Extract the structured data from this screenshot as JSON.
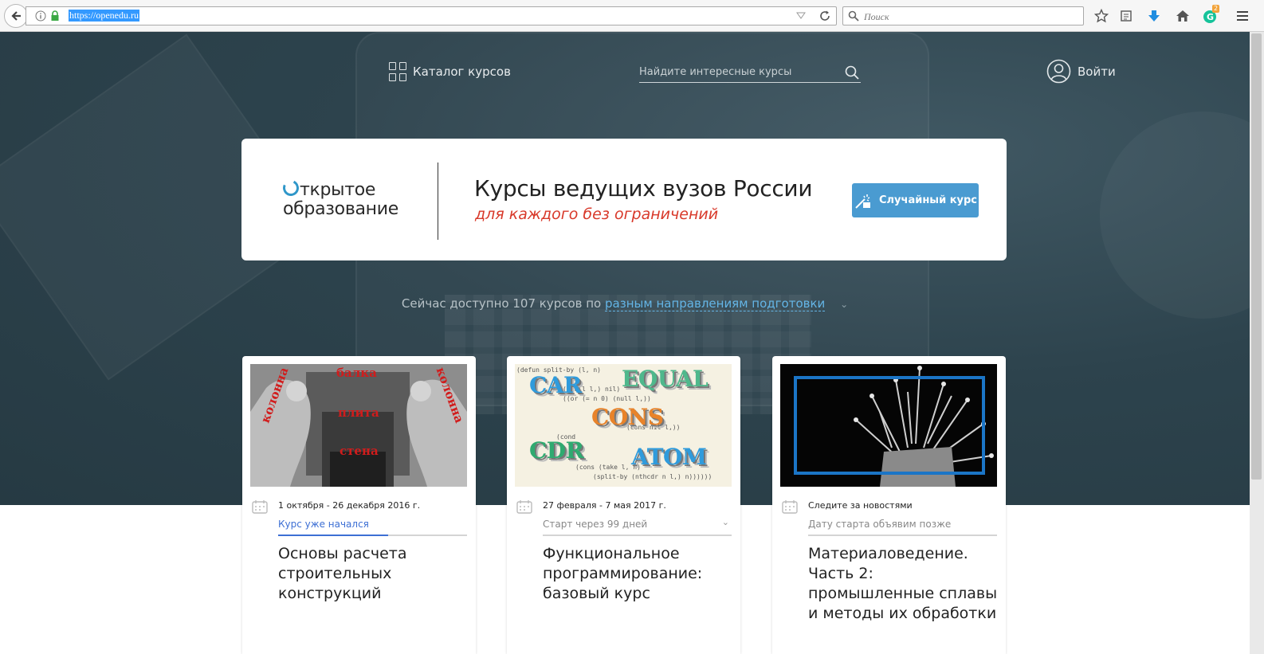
{
  "browser": {
    "url": "https://openedu.ru",
    "search_placeholder": "Поиск",
    "badge_count": "2"
  },
  "nav": {
    "catalog_label": "Каталог курсов",
    "search_placeholder": "Найдите интересные курсы",
    "login_label": "Войти"
  },
  "banner": {
    "logo_line1": "ткрытое",
    "logo_line2": "образование",
    "headline": "Курсы ведущих вузов России",
    "subline": "для каждого без ограничений",
    "random_button": "Случайный курс"
  },
  "available": {
    "prefix": "Сейчас доступно 107 курсов по",
    "link": "разным направлениям подготовки"
  },
  "cards": [
    {
      "dates": "1 октября - 26 декабря 2016 г.",
      "status": "Курс уже начался",
      "title": "Основы расчета строительных конструкций",
      "thumb_labels": [
        "колонна",
        "балка",
        "колонна",
        "плита",
        "стена"
      ]
    },
    {
      "dates": "27 февраля - 7 мая 2017 г.",
      "status": "Старт через 99 дней",
      "title": "Функциональное программирование: базовый курс",
      "thumb_words": [
        "CAR",
        "EQUAL",
        "CONS",
        "CDR",
        "ATOM"
      ],
      "thumb_code": [
        "(defun split-by (l‚ n)",
        "(cond",
        "((null l‚) nil)",
        "((or (= n 0) (null l‚))",
        "(cons nil l‚))",
        "(t",
        "(cons (take l‚ n)",
        "(split-by (nthcdr n l‚) n))))))"
      ]
    },
    {
      "dates": "Следите за новостями",
      "status": "Дату старта объявим позже",
      "title": "Материаловедение. Часть 2: промышленные сплавы и методы их обработки"
    }
  ]
}
